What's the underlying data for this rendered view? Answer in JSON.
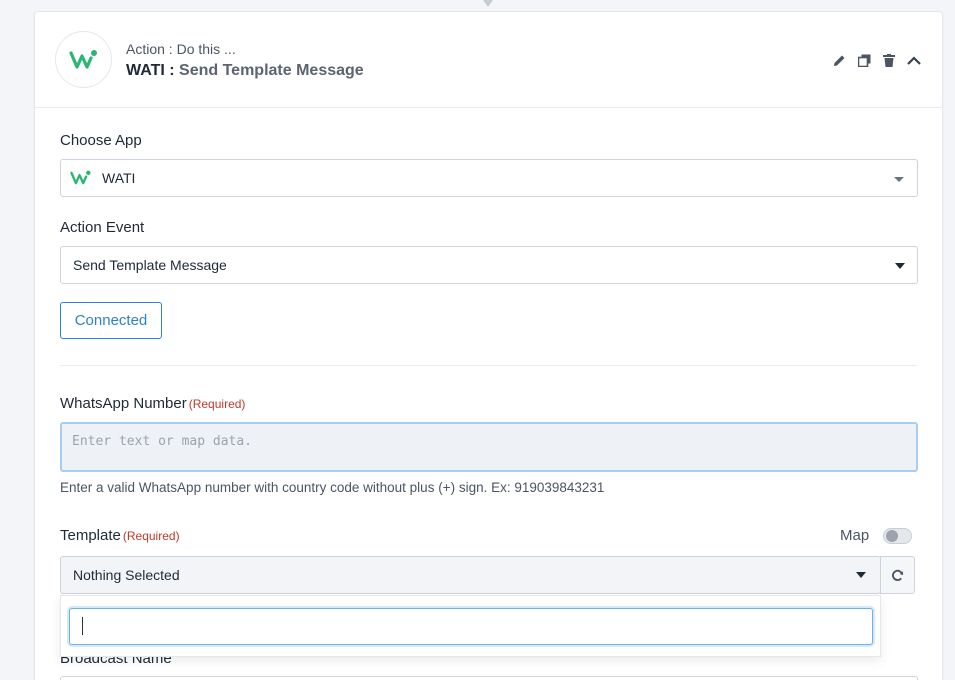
{
  "step": {
    "subtitle": "Action : Do this ...",
    "app_name": "WATI :",
    "event_name": "Send Template Message"
  },
  "header_icons": [
    "pencil-icon",
    "copy-icon",
    "trash-icon",
    "chevron-up-icon"
  ],
  "choose_app": {
    "label": "Choose App",
    "value": "WATI"
  },
  "action_event": {
    "label": "Action Event",
    "value": "Send Template Message"
  },
  "connection": {
    "button_label": "Connected"
  },
  "whatsapp_number": {
    "label": "WhatsApp Number",
    "required": "(Required)",
    "placeholder": "Enter text or map data.",
    "hint": "Enter a valid WhatsApp number with country code without plus (+) sign. Ex: 919039843231"
  },
  "template": {
    "label": "Template",
    "required": "(Required)",
    "map_label": "Map",
    "map_enabled": false,
    "selected": "Nothing Selected",
    "search_value": ""
  },
  "broadcast_name": {
    "label": "Broadcast Name"
  },
  "colors": {
    "accent": "#2f7fd1",
    "required": "#c0392b",
    "wati_green": "#2bb673",
    "focus": "#a9cdf0"
  }
}
